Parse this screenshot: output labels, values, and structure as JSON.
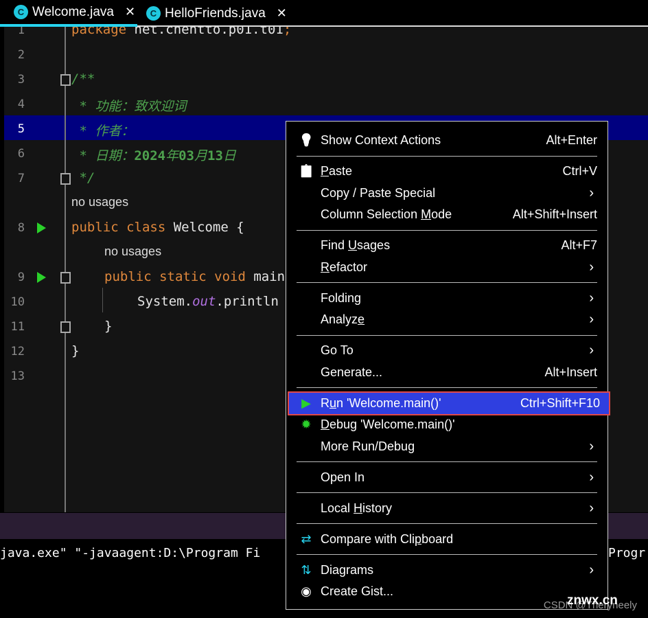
{
  "tabs": [
    {
      "label": "Welcome.java",
      "active": true,
      "icon": "java-class-icon"
    },
    {
      "label": "HelloFriends.java",
      "active": false,
      "icon": "java-class-icon"
    }
  ],
  "editor": {
    "lines": [
      {
        "n": "1",
        "indent": 0,
        "tokens": [
          [
            "kw",
            "package "
          ],
          [
            "pl",
            "net.chentto.p01.t01"
          ],
          [
            "kw",
            ";"
          ]
        ]
      },
      {
        "n": "2",
        "indent": 0,
        "tokens": []
      },
      {
        "n": "3",
        "indent": 0,
        "tokens": [
          [
            "cm",
            "/**"
          ]
        ]
      },
      {
        "n": "4",
        "indent": 0,
        "tokens": [
          [
            "cm",
            " * 功能：致欢迎词"
          ]
        ]
      },
      {
        "n": "5",
        "indent": 0,
        "tokens": [
          [
            "cm",
            " * 作者："
          ]
        ]
      },
      {
        "n": "6",
        "indent": 0,
        "tokens": [
          [
            "cm",
            " * 日期："
          ],
          [
            "cmb",
            "2024"
          ],
          [
            "cm",
            "年"
          ],
          [
            "cmb",
            "03"
          ],
          [
            "cm",
            "月"
          ],
          [
            "cmb",
            "13"
          ],
          [
            "cm",
            "日"
          ]
        ]
      },
      {
        "n": "7",
        "indent": 0,
        "tokens": [
          [
            "cm",
            " */"
          ]
        ]
      },
      {
        "n": "",
        "indent": 0,
        "hint": "no usages"
      },
      {
        "n": "8",
        "indent": 0,
        "tokens": [
          [
            "kw",
            "public class "
          ],
          [
            "pl",
            "Welcome {"
          ]
        ]
      },
      {
        "n": "",
        "indent": 1,
        "hint": "no usages"
      },
      {
        "n": "9",
        "indent": 1,
        "tokens": [
          [
            "kw",
            "public static void "
          ],
          [
            "pl",
            "main"
          ]
        ]
      },
      {
        "n": "10",
        "indent": 2,
        "tokens": [
          [
            "pl",
            "System."
          ],
          [
            "fld",
            "out"
          ],
          [
            "pl",
            ".println"
          ]
        ]
      },
      {
        "n": "11",
        "indent": 1,
        "tokens": [
          [
            "pl",
            "}"
          ]
        ]
      },
      {
        "n": "12",
        "indent": 0,
        "tokens": [
          [
            "pl",
            "}"
          ]
        ]
      },
      {
        "n": "13",
        "indent": 0,
        "tokens": []
      }
    ],
    "current_line": "5"
  },
  "console": {
    "left": "java.exe\" \"-javaagent:D:\\Program Fi",
    "right": "Progr"
  },
  "menu": {
    "items": [
      {
        "icon": "lightbulb-icon",
        "label": "Show Context Actions",
        "shortcut": "Alt+Enter"
      },
      {
        "sep": true
      },
      {
        "icon": "clipboard-icon",
        "label": "Paste",
        "u": 0,
        "shortcut": "Ctrl+V"
      },
      {
        "label": "Copy / Paste Special",
        "submenu": true
      },
      {
        "label": "Column Selection Mode",
        "u": 17,
        "shortcut": "Alt+Shift+Insert"
      },
      {
        "sep": true
      },
      {
        "label": "Find Usages",
        "u": 5,
        "shortcut": "Alt+F7"
      },
      {
        "label": "Refactor",
        "u": 0,
        "submenu": true
      },
      {
        "sep": true
      },
      {
        "label": "Folding",
        "submenu": true
      },
      {
        "label": "Analyze",
        "u": 6,
        "submenu": true
      },
      {
        "sep": true
      },
      {
        "label": "Go To",
        "submenu": true
      },
      {
        "label": "Generate...",
        "shortcut": "Alt+Insert"
      },
      {
        "sep": true
      },
      {
        "icon": "run-icon",
        "label": "Run 'Welcome.main()'",
        "u": 1,
        "shortcut": "Ctrl+Shift+F10",
        "selected": true
      },
      {
        "icon": "debug-icon",
        "label": "Debug 'Welcome.main()'",
        "u": 0
      },
      {
        "label": "More Run/Debug",
        "submenu": true
      },
      {
        "sep": true
      },
      {
        "label": "Open In",
        "submenu": true
      },
      {
        "sep": true
      },
      {
        "label": "Local History",
        "u": 6,
        "submenu": true
      },
      {
        "sep": true
      },
      {
        "icon": "compare-icon",
        "label": "Compare with Clipboard",
        "u": 16
      },
      {
        "sep": true
      },
      {
        "icon": "diagram-icon",
        "label": "Diagrams",
        "submenu": true
      },
      {
        "icon": "github-icon",
        "label": "Create Gist..."
      }
    ]
  },
  "watermark": "CSDN @Theryneely",
  "watermark2": "znwx.cn",
  "colors": {
    "accent": "#27d3ee",
    "selection": "#2f3fe0",
    "current_line": "#000080",
    "highlight_border": "#e04848"
  }
}
